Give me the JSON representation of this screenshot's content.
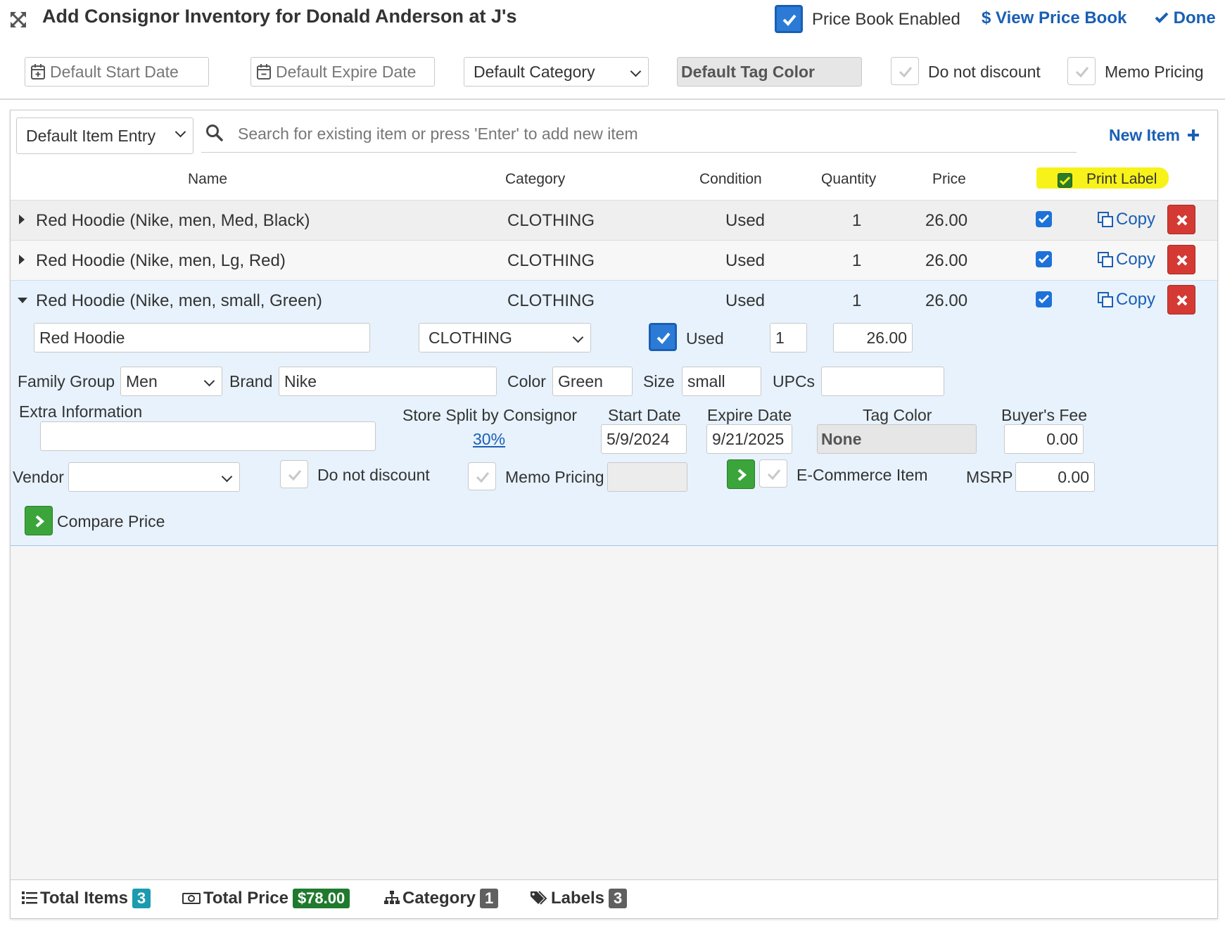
{
  "header": {
    "title": "Add Consignor Inventory for Donald Anderson at J's",
    "price_book_enabled_label": "Price Book Enabled",
    "view_price_book_label": "View Price Book",
    "done_label": "Done"
  },
  "defaults": {
    "start_date_placeholder": "Default Start Date",
    "expire_date_placeholder": "Default Expire Date",
    "category_select": "Default Category",
    "tag_color_button": "Default Tag Color",
    "do_not_discount_label": "Do not discount",
    "memo_pricing_label": "Memo Pricing"
  },
  "entry": {
    "mode_select": "Default Item Entry",
    "search_placeholder": "Search for existing item or press 'Enter' to add new item",
    "new_item_label": "New Item"
  },
  "columns": {
    "name": "Name",
    "category": "Category",
    "condition": "Condition",
    "quantity": "Quantity",
    "price": "Price",
    "print_label": "Print Label"
  },
  "rows": [
    {
      "name": "Red Hoodie (Nike, men, Med, Black)",
      "category": "CLOTHING",
      "condition": "Used",
      "quantity": "1",
      "price": "26.00",
      "copy": "Copy",
      "print": true
    },
    {
      "name": "Red Hoodie (Nike, men, Lg, Red)",
      "category": "CLOTHING",
      "condition": "Used",
      "quantity": "1",
      "price": "26.00",
      "copy": "Copy",
      "print": true
    },
    {
      "name": "Red Hoodie (Nike, men, small, Green)",
      "category": "CLOTHING",
      "condition": "Used",
      "quantity": "1",
      "price": "26.00",
      "copy": "Copy",
      "print": true
    }
  ],
  "detail": {
    "name_value": "Red Hoodie",
    "category_value": "CLOTHING",
    "condition_label": "Used",
    "quantity_value": "1",
    "price_value": "26.00",
    "family_group_label": "Family Group",
    "family_group_value": "Men",
    "brand_label": "Brand",
    "brand_value": "Nike",
    "color_label": "Color",
    "color_value": "Green",
    "size_label": "Size",
    "size_value": "small",
    "upcs_label": "UPCs",
    "upcs_value": "",
    "extra_info_label": "Extra Information",
    "extra_info_value": "",
    "store_split_label": "Store Split by Consignor",
    "store_split_value": "30%",
    "start_date_label": "Start Date",
    "start_date_value": "5/9/2024",
    "expire_date_label": "Expire Date",
    "expire_date_value": "9/21/2025",
    "tag_color_label": "Tag Color",
    "tag_color_value": "None",
    "buyers_fee_label": "Buyer's Fee",
    "buyers_fee_value": "0.00",
    "vendor_label": "Vendor",
    "vendor_value": "",
    "do_not_discount_label": "Do not discount",
    "memo_pricing_label": "Memo Pricing",
    "ecommerce_label": "E-Commerce Item",
    "msrp_label": "MSRP",
    "msrp_value": "0.00",
    "compare_price_label": "Compare Price"
  },
  "footer": {
    "total_items_label": "Total Items",
    "total_items_value": "3",
    "total_price_label": "Total Price",
    "total_price_value": "$78.00",
    "category_label": "Category",
    "category_value": "1",
    "labels_label": "Labels",
    "labels_value": "3"
  },
  "colors": {
    "accent_blue": "#1a5fb4",
    "expanded_row_bg": "#e7f2fc",
    "delete_red": "#d43a33",
    "go_green": "#3ba53b",
    "highlight_yellow": "#f7f21a"
  },
  "icons": [
    "expand-arrows-icon",
    "checkmark-icon",
    "dollar-icon",
    "calendar-plus-icon",
    "calendar-minus-icon",
    "search-icon",
    "plus-icon",
    "copy-icon",
    "times-icon",
    "chevron-right-icon",
    "list-icon",
    "money-icon",
    "sitemap-icon",
    "tags-icon"
  ]
}
